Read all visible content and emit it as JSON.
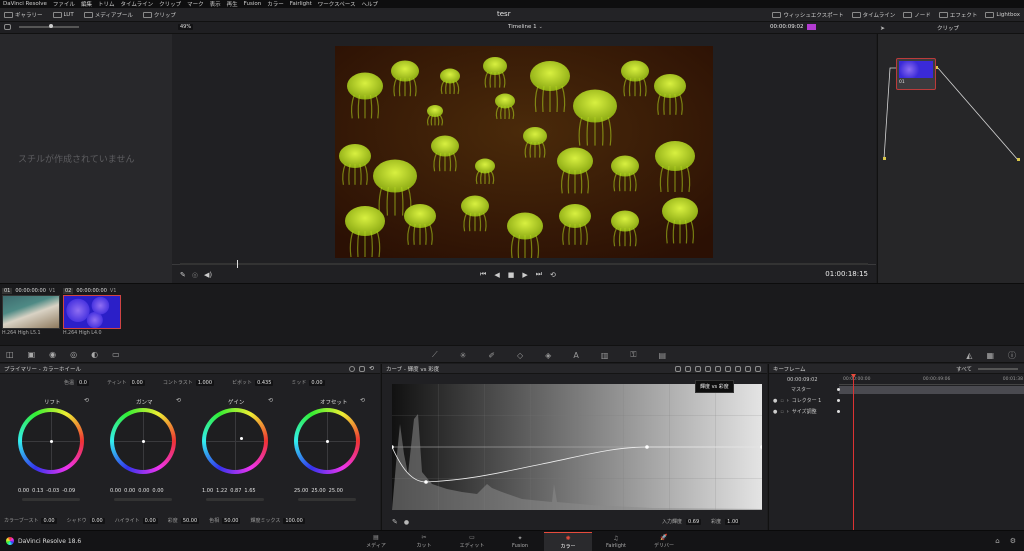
{
  "menubar": {
    "items": [
      "DaVinci Resolve",
      "ファイル",
      "編集",
      "トリム",
      "タイムライン",
      "クリップ",
      "マーク",
      "表示",
      "再生",
      "Fusion",
      "カラー",
      "Fairlight",
      "ワークスペース",
      "ヘルプ"
    ]
  },
  "project_title": "tesr",
  "toolbar": {
    "left": [
      "ギャラリー",
      "LUT",
      "メディアプール",
      "クリップ"
    ],
    "right": [
      "ウィッシュエクスポート",
      "タイムライン",
      "ノード",
      "エフェクト",
      "Lightbox"
    ]
  },
  "subbar": {
    "zoom": "49%",
    "timeline_name": "Timeline 1",
    "timecode": "00:00:09:02",
    "clip_menu": "クリップ"
  },
  "stills": {
    "empty_message": "スチルが作成されていません"
  },
  "viewer": {
    "timecode": "01:00:18:15"
  },
  "node": {
    "label": "01"
  },
  "clips": [
    {
      "num": "01",
      "tc": "00:00:00:00",
      "track": "V1",
      "codec": "H.264 High L5.1"
    },
    {
      "num": "02",
      "tc": "00:00:00:00",
      "track": "V1",
      "codec": "H.264 High L4.0"
    }
  ],
  "wheels_panel": {
    "title": "プライマリー - カラーホイール",
    "top_params": [
      {
        "label": "色温",
        "value": "0.0"
      },
      {
        "label": "ティント",
        "value": "0.00"
      },
      {
        "label": "コントラスト",
        "value": "1.000"
      },
      {
        "label": "ピボット",
        "value": "0.435"
      },
      {
        "label": "ミッド",
        "value": "0.00"
      }
    ],
    "wheels": [
      {
        "name": "リフト",
        "values": [
          "0.00",
          "0.13",
          "-0.03",
          "-0.09"
        ]
      },
      {
        "name": "ガンマ",
        "values": [
          "0.00",
          "0.00",
          "0.00",
          "0.00"
        ]
      },
      {
        "name": "ゲイン",
        "values": [
          "1.00",
          "1.22",
          "0.87",
          "1.65"
        ]
      },
      {
        "name": "オフセット",
        "values": [
          "25.00",
          "25.00",
          "25.00"
        ]
      }
    ],
    "bottom_params": [
      {
        "label": "カラーブースト",
        "value": "0.00"
      },
      {
        "label": "シャドウ",
        "value": "0.00"
      },
      {
        "label": "ハイライト",
        "value": "0.00"
      },
      {
        "label": "彩度",
        "value": "50.00"
      },
      {
        "label": "色相",
        "value": "50.00"
      },
      {
        "label": "輝度ミックス",
        "value": "100.00"
      }
    ]
  },
  "curves_panel": {
    "title": "カーブ - 輝度 vs 彩度",
    "tooltip": "輝度 vs 彩度",
    "input_label": "入力輝度",
    "input_value": "0.69",
    "sat_label": "彩度",
    "sat_value": "1.00"
  },
  "keyframes_panel": {
    "title": "キーフレーム",
    "filter": "すべて",
    "timecode": "00:00:09:02",
    "ruler": [
      "00:00:00:00",
      "00:00:49:06",
      "00:01:38"
    ],
    "tracks": [
      "マスター",
      "コレクター 1",
      "サイズ調整"
    ]
  },
  "pagebar": {
    "app_name": "DaVinci Resolve 18.6",
    "pages": [
      "メディア",
      "カット",
      "エディット",
      "Fusion",
      "カラー",
      "Fairlight",
      "デリバー"
    ],
    "active": "カラー"
  },
  "colors": {
    "accent": "#e64b3c",
    "jelly": "#b5d91e",
    "bg": "#1c1c1e"
  }
}
